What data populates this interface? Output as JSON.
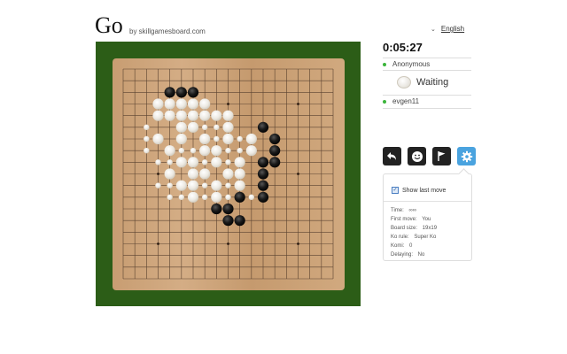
{
  "header": {
    "title": "Go",
    "subtitle": "by skillgamesboard.com",
    "language": "English"
  },
  "game": {
    "timer": "0:05:27",
    "players": [
      {
        "name": "Anonymous"
      },
      {
        "name": "evgen11"
      }
    ],
    "status": "Waiting",
    "board_size": 19,
    "star_points": [
      [
        3,
        3
      ],
      [
        3,
        9
      ],
      [
        3,
        15
      ],
      [
        9,
        3
      ],
      [
        9,
        9
      ],
      [
        9,
        15
      ],
      [
        15,
        3
      ],
      [
        15,
        9
      ],
      [
        15,
        15
      ]
    ],
    "black_stones": [
      [
        4,
        2
      ],
      [
        5,
        2
      ],
      [
        6,
        2
      ],
      [
        12,
        5
      ],
      [
        13,
        6
      ],
      [
        13,
        7
      ],
      [
        12,
        8
      ],
      [
        13,
        8
      ],
      [
        12,
        9
      ],
      [
        12,
        10
      ],
      [
        12,
        11
      ],
      [
        10,
        11
      ],
      [
        9,
        12
      ],
      [
        8,
        12
      ],
      [
        9,
        13
      ],
      [
        10,
        13
      ]
    ],
    "white_stones": [
      [
        3,
        3
      ],
      [
        4,
        3
      ],
      [
        5,
        3
      ],
      [
        6,
        3
      ],
      [
        7,
        3
      ],
      [
        3,
        4
      ],
      [
        4,
        4
      ],
      [
        5,
        4
      ],
      [
        6,
        4
      ],
      [
        7,
        4
      ],
      [
        8,
        4
      ],
      [
        9,
        4
      ],
      [
        5,
        5
      ],
      [
        6,
        5
      ],
      [
        9,
        5
      ],
      [
        3,
        6
      ],
      [
        5,
        6
      ],
      [
        7,
        6
      ],
      [
        9,
        6
      ],
      [
        11,
        6
      ],
      [
        4,
        7
      ],
      [
        7,
        7
      ],
      [
        8,
        7
      ],
      [
        11,
        7
      ],
      [
        5,
        8
      ],
      [
        6,
        8
      ],
      [
        8,
        8
      ],
      [
        10,
        8
      ],
      [
        4,
        9
      ],
      [
        6,
        9
      ],
      [
        7,
        9
      ],
      [
        9,
        9
      ],
      [
        10,
        9
      ],
      [
        5,
        10
      ],
      [
        6,
        10
      ],
      [
        8,
        10
      ],
      [
        10,
        10
      ],
      [
        6,
        11
      ],
      [
        8,
        11
      ]
    ],
    "small_white_stones": [
      [
        2,
        5
      ],
      [
        2,
        6
      ],
      [
        2,
        7
      ],
      [
        3,
        8
      ],
      [
        4,
        8
      ],
      [
        3,
        10
      ],
      [
        4,
        10
      ],
      [
        4,
        11
      ],
      [
        7,
        5
      ],
      [
        8,
        5
      ],
      [
        8,
        6
      ],
      [
        10,
        6
      ],
      [
        7,
        8
      ],
      [
        9,
        8
      ],
      [
        7,
        10
      ],
      [
        9,
        10
      ],
      [
        5,
        11
      ],
      [
        7,
        11
      ],
      [
        9,
        11
      ],
      [
        11,
        11
      ],
      [
        6,
        7
      ],
      [
        10,
        7
      ],
      [
        9,
        7
      ],
      [
        5,
        7
      ]
    ]
  },
  "toolbar": {
    "buttons": [
      {
        "icon": "undo-arrow-icon"
      },
      {
        "icon": "smiley-icon"
      },
      {
        "icon": "flag-icon"
      },
      {
        "icon": "gear-icon"
      }
    ]
  },
  "settings": {
    "show_last_move_label": "Show last move",
    "show_last_move_checked": true,
    "rows": [
      {
        "key": "Time:",
        "value": "∞∞"
      },
      {
        "key": "First move:",
        "value": "You"
      },
      {
        "key": "Board size:",
        "value": "19x19"
      },
      {
        "key": "Ko rule:",
        "value": "Super Ko"
      },
      {
        "key": "Komi:",
        "value": "0"
      },
      {
        "key": "Delaying:",
        "value": "No"
      }
    ]
  },
  "colors": {
    "board_bg": "#2c5d17",
    "wood": "#c9a27a",
    "accent": "#4aa3df",
    "online": "#3bb53b"
  }
}
